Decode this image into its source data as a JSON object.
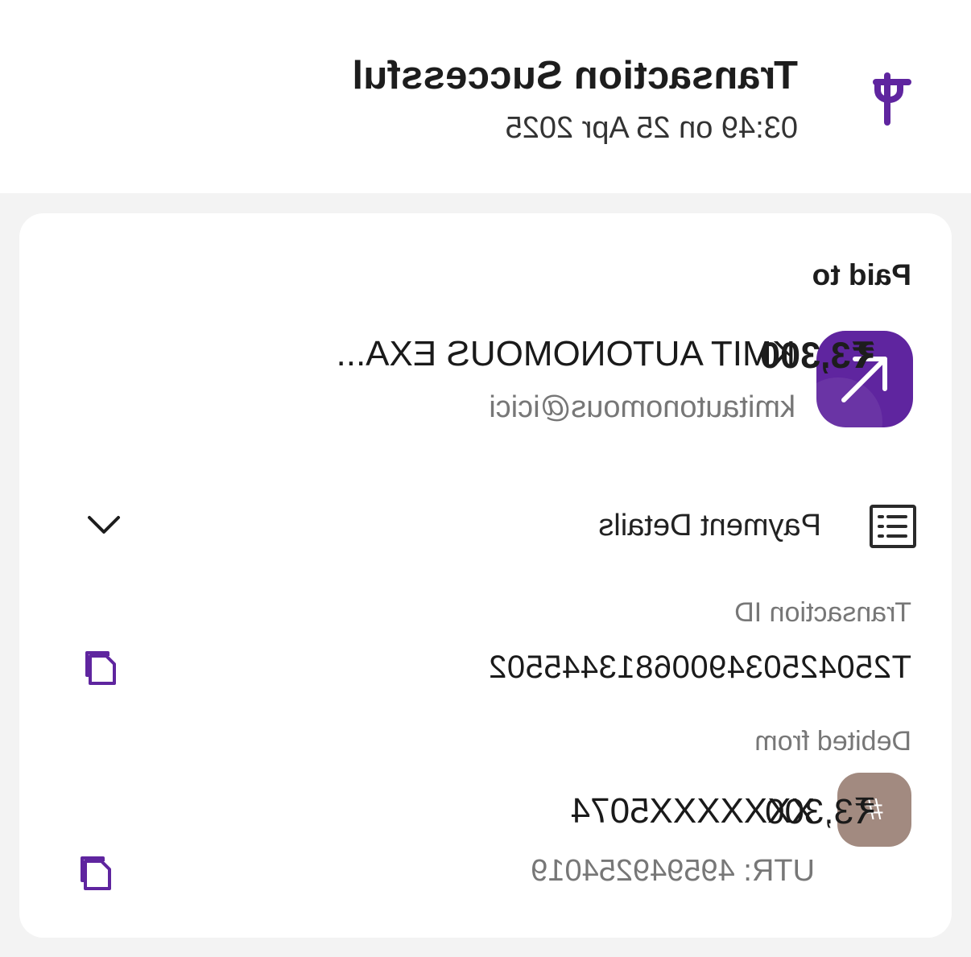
{
  "header": {
    "title": "Transaction Successful",
    "timestamp": "03:49 on 25 Apr 2025",
    "logo_icon": "phonepe-logo-icon"
  },
  "paid_to": {
    "label": "Paid to",
    "payee_name": "KMIT AUTONOMOUS EXA...",
    "payee_upi": "kmitautonomous@icici",
    "amount": "₹3,300",
    "avatar_icon": "arrow-up-left-icon"
  },
  "payment_details": {
    "label": "Payment Details",
    "icon": "receipt-icon",
    "toggle_icon": "chevron-down-icon"
  },
  "transaction": {
    "id_label": "Transaction ID",
    "id_value": "T2504250349006813445502",
    "copy_icon": "copy-icon"
  },
  "debited_from": {
    "label": "Debited from",
    "account": "XXXXXXX5074",
    "utr": "UTR: 495949254019",
    "amount": "₹3,300",
    "avatar_glyph": "#",
    "copy_icon": "copy-icon"
  },
  "colors": {
    "brand_purple": "#5f259f",
    "bank_avatar": "#a28a80",
    "page_background": "#f3f3f3",
    "card_background": "#ffffff"
  }
}
